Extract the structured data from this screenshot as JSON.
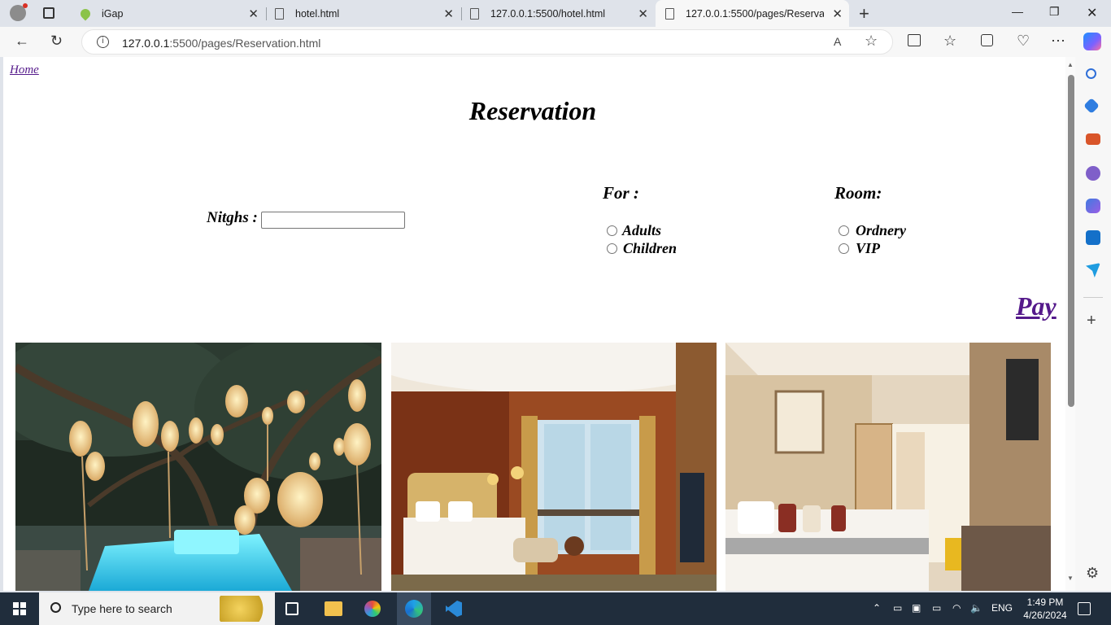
{
  "browser": {
    "tabs": [
      {
        "title": "iGap"
      },
      {
        "title": "hotel.html"
      },
      {
        "title": "127.0.0.1:5500/hotel.html"
      },
      {
        "title": "127.0.0.1:5500/pages/Reservation.html"
      }
    ],
    "address": {
      "host": "127.0.0.1",
      "rest": ":5500/pages/Reservation.html"
    }
  },
  "page": {
    "home_link": "Home",
    "title": "Reservation",
    "nights_label": "Nitghs :",
    "nights_value": "",
    "for_label": "For :",
    "for_options": [
      "Adults",
      "Children"
    ],
    "room_label": "Room:",
    "room_options": [
      "Ordnery",
      "VIP"
    ],
    "pay_link": "Pay"
  },
  "taskbar": {
    "search_placeholder": "Type here to search",
    "language": "ENG",
    "time": "1:49 PM",
    "date": "4/26/2024"
  },
  "colors": {
    "link_visited": "#551a8b",
    "taskbar": "#202d3c",
    "chrome": "#dfe3ea"
  }
}
